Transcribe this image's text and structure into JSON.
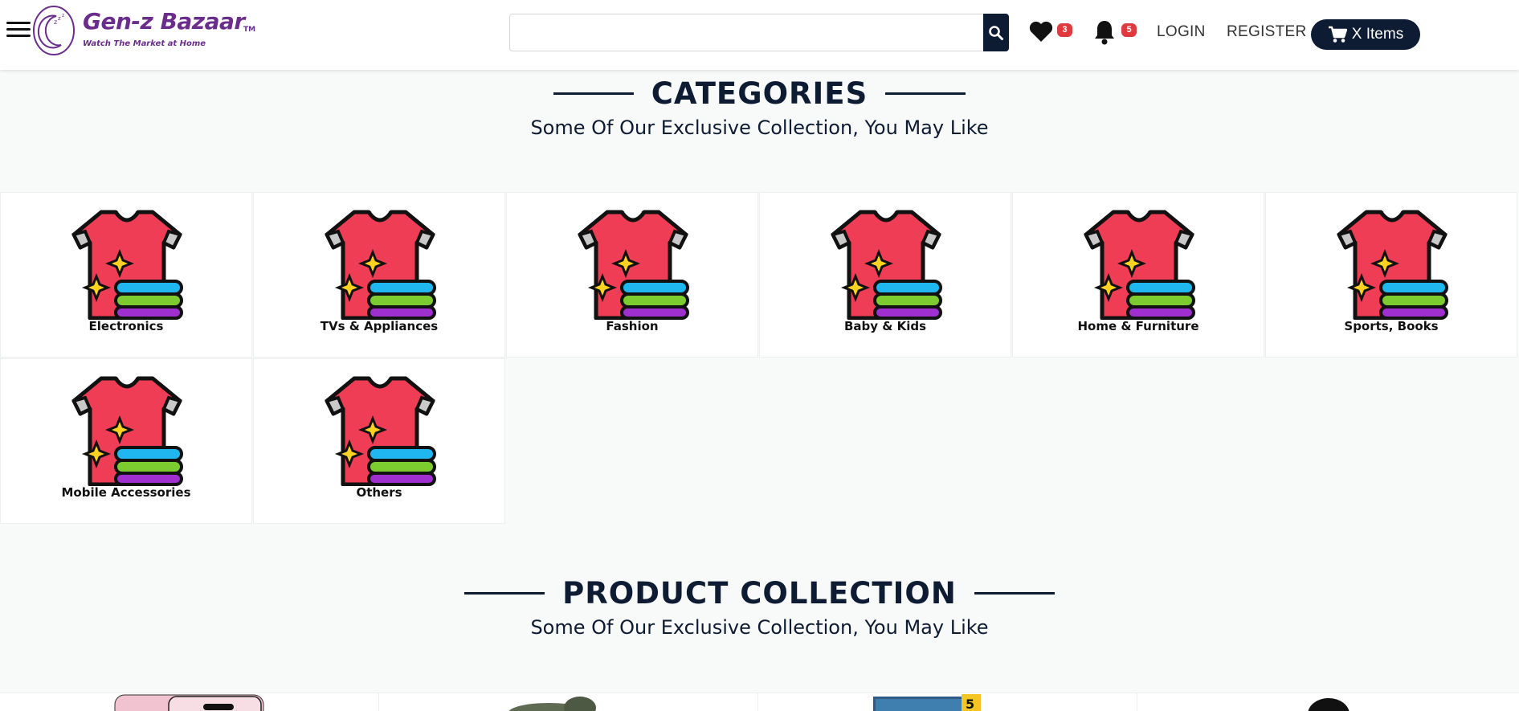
{
  "header": {
    "brand": "Gen-z Bazaar",
    "trademark": "TM",
    "tagline": "Watch The Market at Home",
    "search_placeholder": "",
    "wishlist_count": "3",
    "notification_count": "5",
    "login": "LOGIN",
    "register": "REGISTER",
    "cart_label": "X Items"
  },
  "categories_section": {
    "title": "CATEGORIES",
    "subtitle": "Some Of Our Exclusive Collection, You May Like",
    "items": [
      {
        "label": "Electronics"
      },
      {
        "label": "TVs & Appliances"
      },
      {
        "label": "Fashion"
      },
      {
        "label": "Baby & Kids"
      },
      {
        "label": "Home & Furniture"
      },
      {
        "label": "Sports, Books"
      },
      {
        "label": "Mobile Accessories"
      },
      {
        "label": "Others"
      }
    ]
  },
  "products_section": {
    "title": "PRODUCT COLLECTION",
    "subtitle": "Some Of Our Exclusive Collection, You May Like"
  },
  "colors": {
    "brand_purple": "#6b2d8c",
    "navy": "#0d1b33",
    "badge_red": "#e0393e"
  }
}
